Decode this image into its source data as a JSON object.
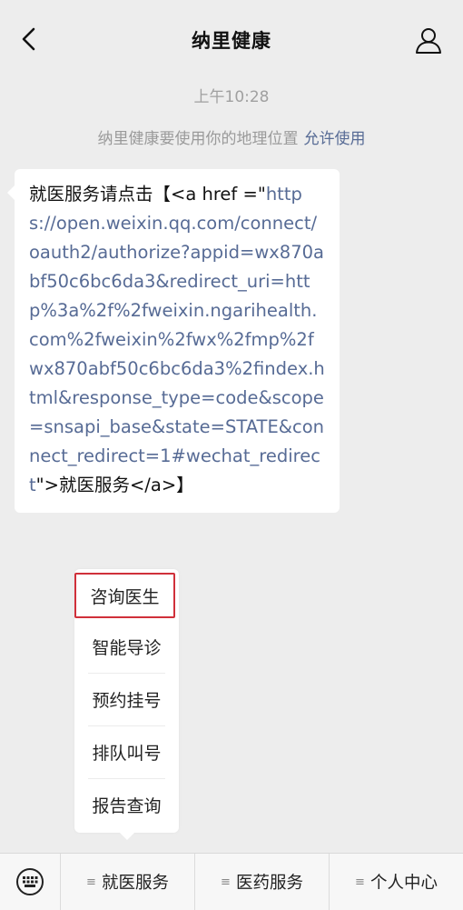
{
  "header": {
    "title": "纳里健康",
    "back_icon": "back-arrow-icon",
    "profile_icon": "person-icon"
  },
  "chat": {
    "timestamp": "上午10:28",
    "location_notice": "纳里健康要使用你的地理位置",
    "allow_label": "允许使用",
    "message": {
      "prefix": "就医服务请点击【<a href =\"",
      "link": "https://open.weixin.qq.com/connect/oauth2/authorize?appid=wx870abf50c6bc6da3&redirect_uri=http%3a%2f%2fweixin.ngarihealth.com%2fweixin%2fwx%2fmp%2fwx870abf50c6bc6da3%2findex.html&response_type=code&scope=snsapi_base&state=STATE&connect_redirect=1#wechat_redirect",
      "suffix": "\">就医服务</a>】"
    }
  },
  "popup_menu": {
    "items": [
      {
        "label": "咨询医生"
      },
      {
        "label": "智能导诊"
      },
      {
        "label": "预约挂号"
      },
      {
        "label": "排队叫号"
      },
      {
        "label": "报告查询"
      }
    ],
    "highlight_color": "#d0303a"
  },
  "bottom_menu": {
    "keyboard_icon": "keyboard-icon",
    "menu_marker": "≡",
    "tabs": [
      {
        "label": "就医服务"
      },
      {
        "label": "医药服务"
      },
      {
        "label": "个人中心"
      }
    ]
  },
  "colors": {
    "background": "#ededed",
    "link": "#576b95"
  }
}
